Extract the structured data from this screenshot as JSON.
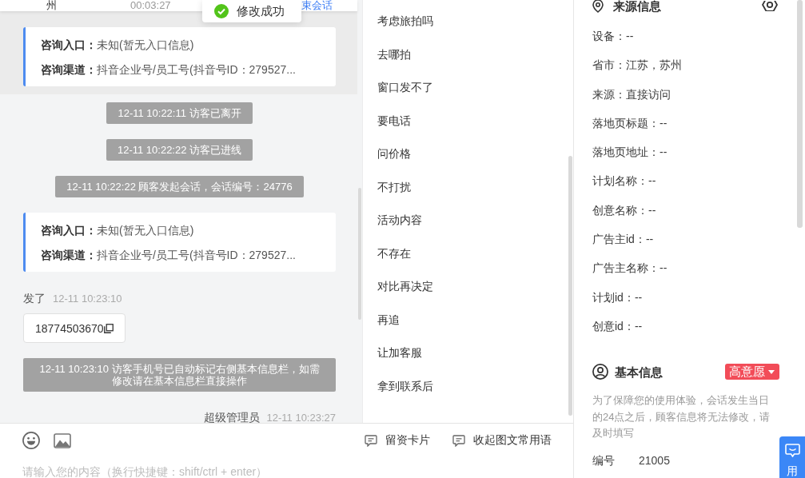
{
  "toast": {
    "text": "修改成功"
  },
  "session_row": {
    "cells": [
      {
        "kind": "name",
        "text": "州"
      },
      {
        "kind": "time",
        "text": "00:03:27"
      }
    ],
    "link": "束会话"
  },
  "history": {
    "fields": [
      {
        "label": "咨询入口：",
        "value": "未知(暂无入口信息)"
      },
      {
        "label": "咨询渠道：",
        "value": "抖音企业号/员工号(抖音号ID：279527..."
      }
    ]
  },
  "chat": {
    "messages": [
      {
        "kind": "system",
        "text": "12-11 10:22:11 访客已离开"
      },
      {
        "kind": "system",
        "text": "12-11 10:22:22 访客已进线"
      },
      {
        "kind": "system",
        "text": "12-11 10:22:22 顾客发起会话，会话编号：24776"
      },
      {
        "kind": "info_card",
        "fields": [
          {
            "label": "咨询入口：",
            "value": "未知(暂无入口信息)"
          },
          {
            "label": "咨询渠道：",
            "value": "抖音企业号/员工号(抖音号ID：279527..."
          }
        ]
      },
      {
        "kind": "visitor",
        "sender": "发了",
        "time": "12-11 10:23:10",
        "text": "18774503670"
      },
      {
        "kind": "system",
        "text": "12-11 10:23:10 访客手机号已自动标记右侧基本信息栏，如需修改请在基本信息栏直接操作"
      },
      {
        "kind": "agent",
        "sender": "超级管理员",
        "time": "12-11 10:23:27"
      }
    ]
  },
  "quick_phrases": {
    "items": [
      "考虑旅拍吗",
      "去哪拍",
      "窗口发不了",
      "要电话",
      "问价格",
      "不打扰",
      "活动内容",
      "不存在",
      "对比再决定",
      "再追",
      "让加客服",
      "拿到联系后"
    ]
  },
  "composer": {
    "tools": [
      {
        "label": "留资卡片"
      },
      {
        "label": "收起图文常用语"
      }
    ],
    "placeholder": "请输入您的内容（换行快捷键：shift/ctrl + enter）"
  },
  "source_info": {
    "title": "来源信息",
    "rows": [
      "设备：--",
      "省市：江苏，苏州",
      "来源：直接访问",
      "落地页标题：--",
      "落地页地址：--",
      "计划名称：--",
      "创意名称：--",
      "广告主id：--",
      "广告主名称：--",
      "计划id：--",
      "创意id：--"
    ]
  },
  "basic_info": {
    "title": "基本信息",
    "intent_tag": "高意愿",
    "hint": "为了保障您的使用体验，会话发生当日的24点之后，顾客信息将无法修改，请及时填写",
    "fields": [
      {
        "label": "编号",
        "value": "21005"
      }
    ]
  },
  "float_tab": {
    "label": "用"
  }
}
